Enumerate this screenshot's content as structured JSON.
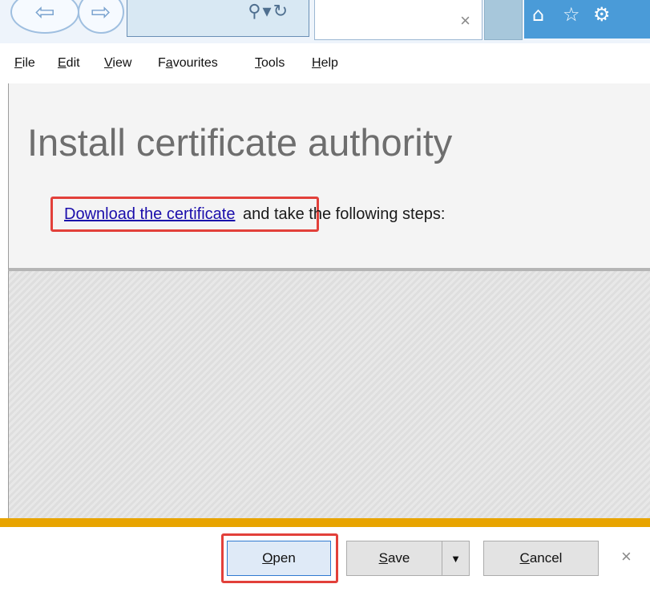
{
  "toolbar": {
    "back_icon": "back-arrow-icon",
    "forward_icon": "forward-arrow-icon",
    "address_value": "",
    "search_icon": "search-icon",
    "refresh_icon": "refresh-icon",
    "tab_title": "",
    "tab_close_glyph": "×",
    "home_icon": "home-icon",
    "favorites_icon": "star-icon",
    "settings_icon": "gear-icon"
  },
  "menu": [
    {
      "mnemonic": "F",
      "rest": "ile"
    },
    {
      "mnemonic": "E",
      "rest": "dit"
    },
    {
      "mnemonic": "V",
      "rest": "iew"
    },
    {
      "pre": "F",
      "mnemonic": "a",
      "rest": "vourites"
    },
    {
      "mnemonic": "T",
      "rest": "ools"
    },
    {
      "mnemonic": "H",
      "rest": "elp"
    }
  ],
  "page": {
    "title": "Install certificate authority",
    "link_text": "Download the certificate",
    "instruction_rest": "and take the following steps:"
  },
  "download_bar": {
    "open": {
      "mnemonic": "O",
      "rest": "pen"
    },
    "save": {
      "mnemonic": "S",
      "rest": "ave"
    },
    "save_arrow_glyph": "▼",
    "cancel": {
      "mnemonic": "C",
      "rest": "ancel"
    },
    "close_glyph": "×"
  },
  "colors": {
    "highlight": "#e2403a",
    "download_bar_accent": "#e8a400",
    "link": "#1a0dab"
  }
}
